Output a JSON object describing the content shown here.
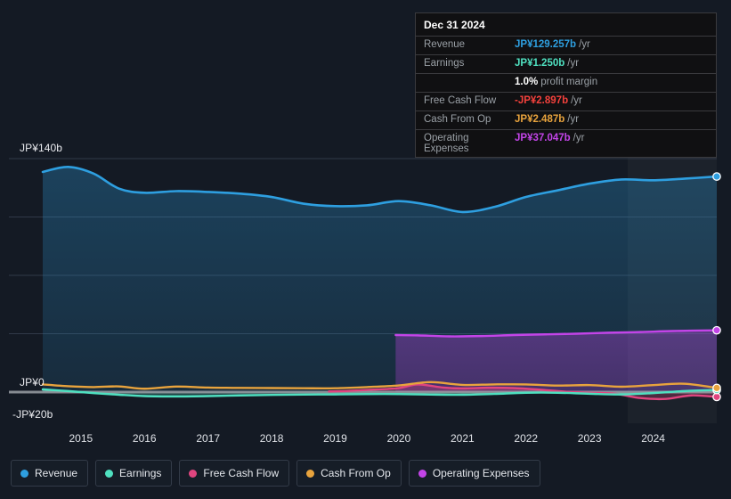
{
  "theme": {
    "background": "#141a24",
    "plot_background": "#141a24",
    "gridline": "#3a4454",
    "zero_line": "#9aa0a6",
    "axis_text": "#e4e7ec",
    "highlight_band": "#1b2738"
  },
  "tooltip": {
    "title": "Dec 31 2024",
    "rows": [
      {
        "key": "Revenue",
        "value": "JP¥129.257b",
        "suffix": "/yr",
        "color": "#2e9fe0"
      },
      {
        "key": "Earnings",
        "value": "JP¥1.250b",
        "suffix": "/yr",
        "color": "#4fe0c0"
      },
      {
        "key": "",
        "value": "1.0%",
        "suffix": "profit margin",
        "color": "#ffffff"
      },
      {
        "key": "Free Cash Flow",
        "value": "-JP¥2.897b",
        "suffix": "/yr",
        "color": "#f4413c"
      },
      {
        "key": "Cash From Op",
        "value": "JP¥2.487b",
        "suffix": "/yr",
        "color": "#e8a33d"
      },
      {
        "key": "Operating Expenses",
        "value": "JP¥37.047b",
        "suffix": "/yr",
        "color": "#c344e8"
      }
    ]
  },
  "legend": {
    "items": [
      {
        "label": "Revenue",
        "color": "#2e9fe0"
      },
      {
        "label": "Earnings",
        "color": "#4fe0c0"
      },
      {
        "label": "Free Cash Flow",
        "color": "#e0457f"
      },
      {
        "label": "Cash From Op",
        "color": "#e8a33d"
      },
      {
        "label": "Operating Expenses",
        "color": "#c344e8"
      }
    ]
  },
  "chart_data": {
    "type": "area",
    "title": "",
    "xlabel": "",
    "ylabel": "",
    "currency": "JP¥",
    "units": "b",
    "grid": true,
    "legend_position": "bottom",
    "ylim": [
      -20,
      150
    ],
    "yticks": [
      140,
      0,
      -20
    ],
    "ytick_labels": [
      "JP¥140b",
      "JP¥0",
      "-JP¥20b"
    ],
    "gridline_values": [
      140,
      105,
      70,
      35,
      0
    ],
    "xticks": [
      2015,
      2016,
      2017,
      2018,
      2019,
      2020,
      2021,
      2022,
      2023,
      2024
    ],
    "xtick_labels": [
      "2015",
      "2016",
      "2017",
      "2018",
      "2019",
      "2020",
      "2021",
      "2022",
      "2023",
      "2024"
    ],
    "xlim": [
      2014.4,
      2025.0
    ],
    "highlight_band_start": 2023.6,
    "highlight_band_end": 2025.0,
    "series": [
      {
        "name": "Revenue",
        "color": "#2e9fe0",
        "fill": true,
        "x": [
          2014.4,
          2014.8,
          2015.2,
          2015.6,
          2016.0,
          2016.5,
          2017.0,
          2017.5,
          2018.0,
          2018.5,
          2019.0,
          2019.5,
          2020.0,
          2020.5,
          2021.0,
          2021.5,
          2022.0,
          2022.5,
          2023.0,
          2023.5,
          2024.0,
          2024.5,
          2025.0
        ],
        "values": [
          132.0,
          135.0,
          131.0,
          122.0,
          119.5,
          120.5,
          120.0,
          119.0,
          117.0,
          113.0,
          111.5,
          112.0,
          114.5,
          112.0,
          108.0,
          111.0,
          117.0,
          121.0,
          125.0,
          127.5,
          127.0,
          128.0,
          129.257
        ],
        "end_point_label": "JP¥129.257b"
      },
      {
        "name": "Earnings",
        "color": "#4fe0c0",
        "fill": true,
        "x": [
          2014.4,
          2014.8,
          2015.2,
          2015.6,
          2016.0,
          2016.5,
          2017.0,
          2017.5,
          2018.0,
          2018.5,
          2019.0,
          2019.5,
          2020.0,
          2020.5,
          2021.0,
          2021.5,
          2022.0,
          2022.5,
          2023.0,
          2023.5,
          2024.0,
          2024.5,
          2025.0
        ],
        "values": [
          1.6,
          0.6,
          -0.6,
          -1.6,
          -2.4,
          -2.6,
          -2.4,
          -2.0,
          -1.7,
          -1.5,
          -1.4,
          -1.2,
          -1.2,
          -1.5,
          -1.6,
          -1.1,
          -0.4,
          -0.4,
          -1.0,
          -1.4,
          -0.6,
          0.6,
          1.25
        ],
        "end_point_label": "JP¥1.250b"
      },
      {
        "name": "Free Cash Flow",
        "color": "#e0457f",
        "fill": true,
        "x": [
          2018.9,
          2019.2,
          2019.6,
          2020.0,
          2020.3,
          2020.7,
          2021.0,
          2021.4,
          2021.8,
          2022.2,
          2022.6,
          2023.0,
          2023.4,
          2023.8,
          2024.2,
          2024.6,
          2025.0
        ],
        "values": [
          0.4,
          0.7,
          1.5,
          2.4,
          4.6,
          2.7,
          2.2,
          2.6,
          2.4,
          1.5,
          0.3,
          -0.4,
          -1.0,
          -3.6,
          -4.1,
          -2.0,
          -2.897
        ],
        "end_point_label": "-JP¥2.897b"
      },
      {
        "name": "Cash From Op",
        "color": "#e8a33d",
        "fill": false,
        "x": [
          2014.4,
          2014.8,
          2015.2,
          2015.6,
          2016.0,
          2016.5,
          2017.0,
          2017.5,
          2018.0,
          2018.5,
          2019.0,
          2019.5,
          2020.0,
          2020.5,
          2021.0,
          2021.5,
          2022.0,
          2022.5,
          2023.0,
          2023.5,
          2024.0,
          2024.5,
          2025.0
        ],
        "values": [
          4.6,
          3.5,
          3.0,
          3.4,
          2.0,
          3.3,
          2.7,
          2.5,
          2.4,
          2.3,
          2.3,
          3.0,
          4.0,
          6.0,
          4.3,
          4.6,
          4.6,
          3.9,
          4.2,
          3.2,
          4.2,
          5.0,
          2.487
        ],
        "end_point_label": "JP¥2.487b"
      },
      {
        "name": "Operating Expenses",
        "color": "#c344e8",
        "fill": true,
        "x": [
          2019.95,
          2020.3,
          2020.8,
          2021.3,
          2021.8,
          2022.3,
          2022.8,
          2023.3,
          2023.8,
          2024.3,
          2025.0
        ],
        "values": [
          34.2,
          34.0,
          33.4,
          33.6,
          34.2,
          34.6,
          35.0,
          35.6,
          36.0,
          36.6,
          37.047
        ],
        "end_point_label": "JP¥37.047b"
      }
    ]
  }
}
